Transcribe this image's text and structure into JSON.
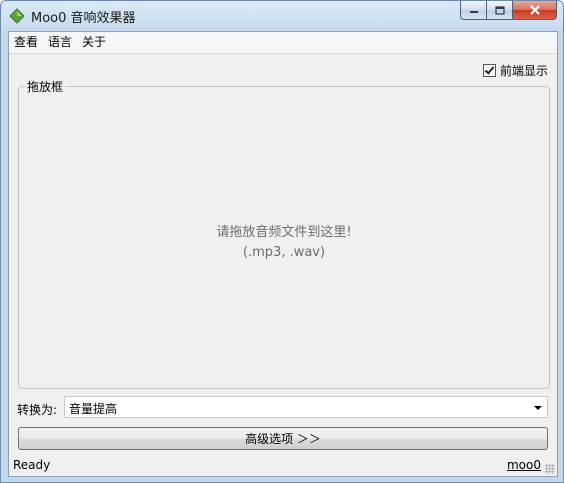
{
  "window": {
    "title": "Moo0 音响效果器"
  },
  "menu": {
    "view": "查看",
    "language": "语言",
    "about": "关于"
  },
  "topmost": {
    "label": "前端显示",
    "checked": true
  },
  "dropbox": {
    "title": "拖放框",
    "hint_line1": "请拖放音频文件到这里!",
    "hint_line2": "(.mp3, .wav)"
  },
  "convert": {
    "label": "转换为:",
    "selected": "音量提高"
  },
  "advanced_button": {
    "label": "高级选项 ＞＞"
  },
  "status": {
    "text": "Ready",
    "link": "moo0"
  },
  "colors": {
    "app_icon": "#5fa33a",
    "close_button": "#c43c22"
  }
}
